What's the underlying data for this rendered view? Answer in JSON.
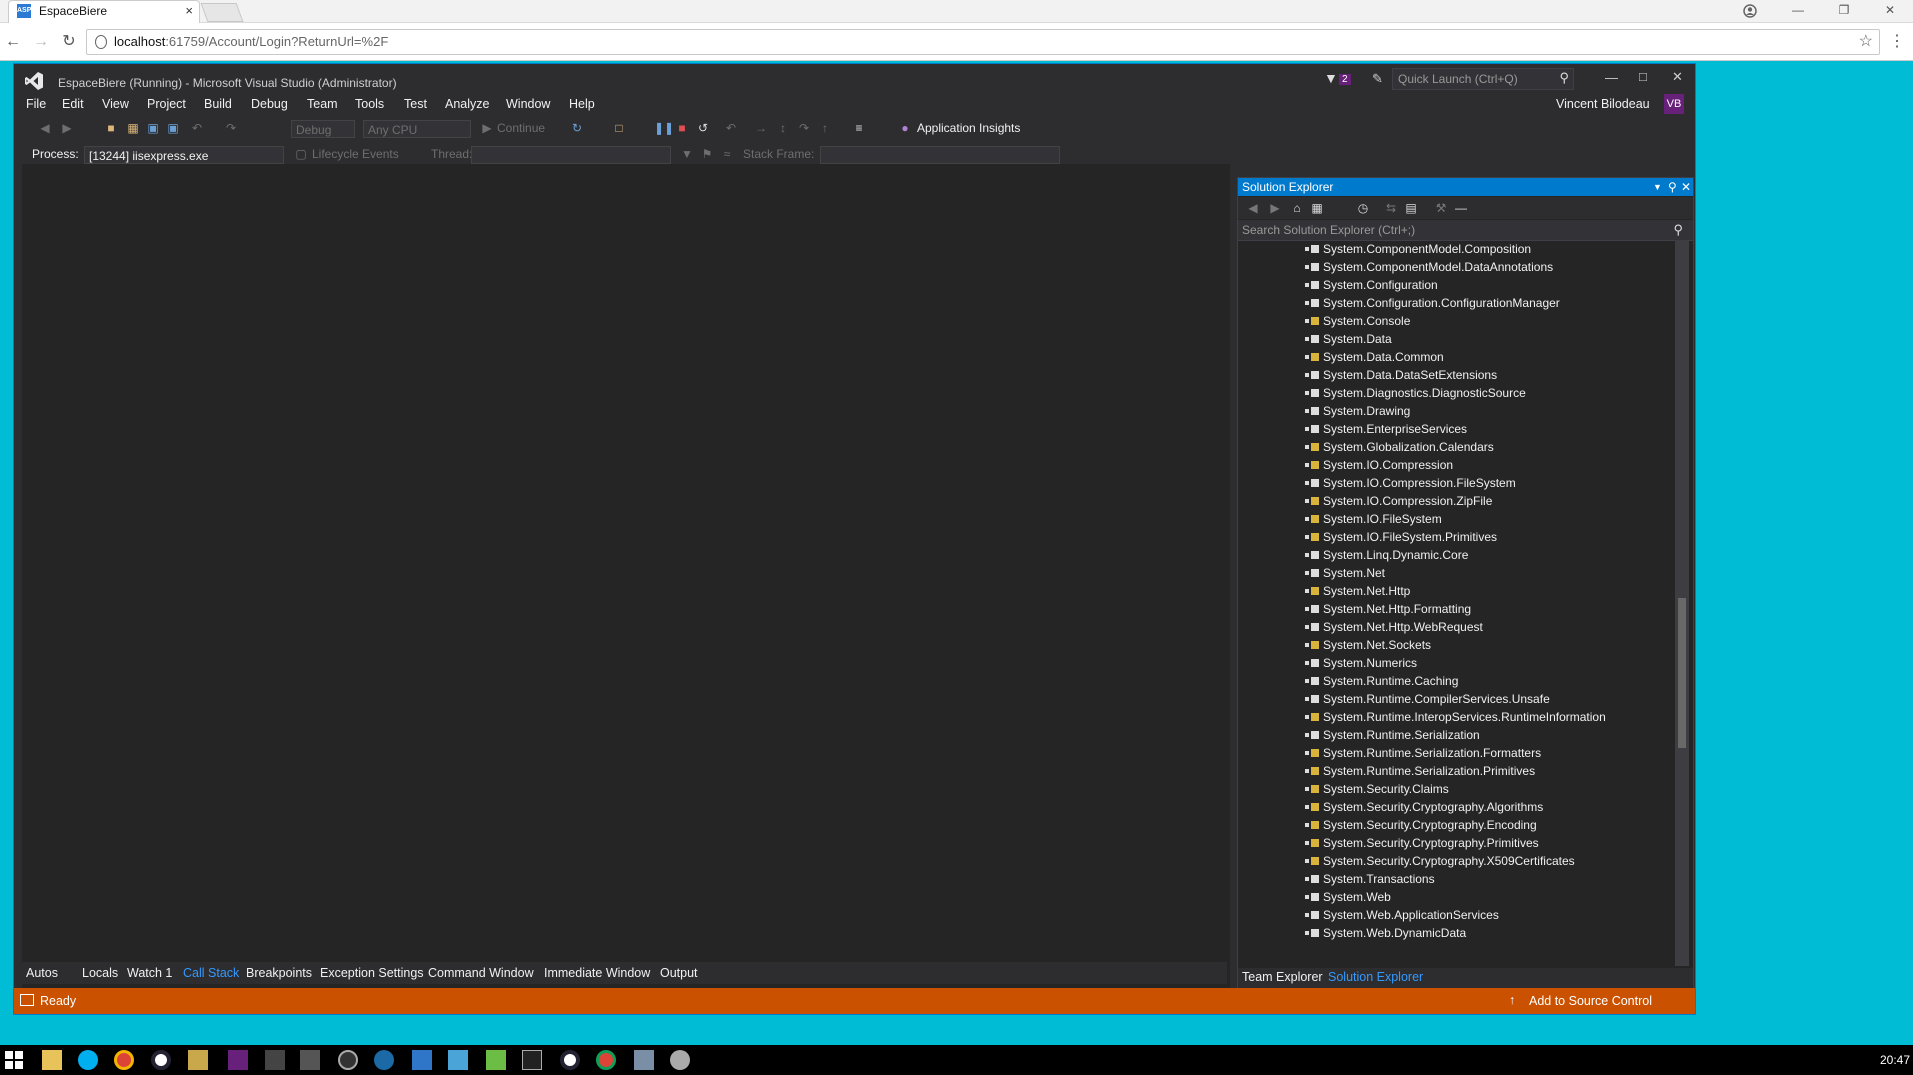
{
  "browser": {
    "tab_title": "EspaceBiere",
    "tab_favicon": "ASP",
    "tab_close": "×",
    "url_host": "localhost",
    "url_path": ":61759/Account/Login?ReturnUrl=%2F"
  },
  "vs": {
    "title": "EspaceBiere (Running) - Microsoft Visual Studio  (Administrator)",
    "notification_count": "2",
    "quick_launch_placeholder": "Quick Launch (Ctrl+Q)",
    "user_name": "Vincent Bilodeau",
    "user_initials": "VB",
    "menu": [
      "File",
      "Edit",
      "View",
      "Project",
      "Build",
      "Debug",
      "Team",
      "Tools",
      "Test",
      "Analyze",
      "Window",
      "Help"
    ],
    "toolbar": {
      "configuration": "Debug",
      "platform": "Any CPU",
      "continue_label": "Continue",
      "app_insights": "Application Insights"
    },
    "debug_location": {
      "process_label": "Process:",
      "process_value": "[13244] iisexpress.exe",
      "lifecycle_label": "Lifecycle Events",
      "thread_label": "Thread:",
      "stack_frame_label": "Stack Frame:"
    },
    "bottom_tabs": [
      "Autos",
      "Locals",
      "Watch 1",
      "Call Stack",
      "Breakpoints",
      "Exception Settings",
      "Command Window",
      "Immediate Window",
      "Output"
    ],
    "bottom_active_tab": "Call Stack",
    "status": {
      "text": "Ready",
      "source_control": "Add to Source Control"
    },
    "solution_explorer": {
      "title": "Solution Explorer",
      "search_placeholder": "Search Solution Explorer (Ctrl+;)",
      "references": [
        {
          "name": "System.ComponentModel.Composition",
          "warn": false
        },
        {
          "name": "System.ComponentModel.DataAnnotations",
          "warn": false
        },
        {
          "name": "System.Configuration",
          "warn": false
        },
        {
          "name": "System.Configuration.ConfigurationManager",
          "warn": false
        },
        {
          "name": "System.Console",
          "warn": true
        },
        {
          "name": "System.Data",
          "warn": false
        },
        {
          "name": "System.Data.Common",
          "warn": true
        },
        {
          "name": "System.Data.DataSetExtensions",
          "warn": false
        },
        {
          "name": "System.Diagnostics.DiagnosticSource",
          "warn": false
        },
        {
          "name": "System.Drawing",
          "warn": false
        },
        {
          "name": "System.EnterpriseServices",
          "warn": false
        },
        {
          "name": "System.Globalization.Calendars",
          "warn": true
        },
        {
          "name": "System.IO.Compression",
          "warn": true
        },
        {
          "name": "System.IO.Compression.FileSystem",
          "warn": false
        },
        {
          "name": "System.IO.Compression.ZipFile",
          "warn": true
        },
        {
          "name": "System.IO.FileSystem",
          "warn": true
        },
        {
          "name": "System.IO.FileSystem.Primitives",
          "warn": true
        },
        {
          "name": "System.Linq.Dynamic.Core",
          "warn": false
        },
        {
          "name": "System.Net",
          "warn": false
        },
        {
          "name": "System.Net.Http",
          "warn": true
        },
        {
          "name": "System.Net.Http.Formatting",
          "warn": false
        },
        {
          "name": "System.Net.Http.WebRequest",
          "warn": false
        },
        {
          "name": "System.Net.Sockets",
          "warn": true
        },
        {
          "name": "System.Numerics",
          "warn": false
        },
        {
          "name": "System.Runtime.Caching",
          "warn": false
        },
        {
          "name": "System.Runtime.CompilerServices.Unsafe",
          "warn": false
        },
        {
          "name": "System.Runtime.InteropServices.RuntimeInformation",
          "warn": true
        },
        {
          "name": "System.Runtime.Serialization",
          "warn": false
        },
        {
          "name": "System.Runtime.Serialization.Formatters",
          "warn": true
        },
        {
          "name": "System.Runtime.Serialization.Primitives",
          "warn": true
        },
        {
          "name": "System.Security.Claims",
          "warn": true
        },
        {
          "name": "System.Security.Cryptography.Algorithms",
          "warn": true
        },
        {
          "name": "System.Security.Cryptography.Encoding",
          "warn": true
        },
        {
          "name": "System.Security.Cryptography.Primitives",
          "warn": true
        },
        {
          "name": "System.Security.Cryptography.X509Certificates",
          "warn": true
        },
        {
          "name": "System.Transactions",
          "warn": false
        },
        {
          "name": "System.Web",
          "warn": false
        },
        {
          "name": "System.Web.ApplicationServices",
          "warn": false
        },
        {
          "name": "System.Web.DynamicData",
          "warn": false
        }
      ],
      "bottom_tabs": [
        "Team Explorer",
        "Solution Explorer"
      ]
    }
  },
  "taskbar": {
    "clock": "20:47"
  },
  "colors": {
    "desktop": "#00bcd4",
    "vs_accent": "#007acc",
    "status_bar": "#ca5100",
    "vs_profile": "#68217a"
  }
}
